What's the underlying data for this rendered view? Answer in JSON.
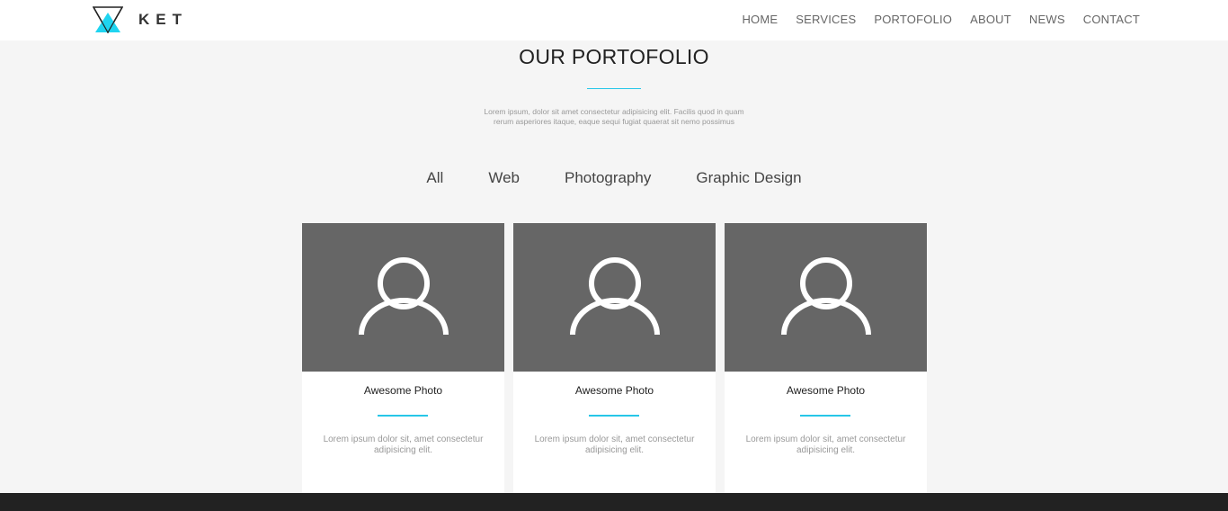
{
  "navbar": {
    "brand": "KET",
    "links": [
      "HOME",
      "SERVICES",
      "PORTOFOLIO",
      "ABOUT",
      "NEWS",
      "CONTACT"
    ]
  },
  "portfolio": {
    "title": "OUR PORTOFOLIO",
    "description": "Lorem ipsum, dolor sit amet consectetur adipisicing elit. Facilis quod in quam rerum asperiores itaque, eaque sequi fugiat quaerat sit nemo possimus",
    "filters": [
      "All",
      "Web",
      "Photography",
      "Graphic Design"
    ],
    "cards": [
      {
        "title": "Awesome Photo",
        "text": "Lorem ipsum dolor sit, amet consectetur adipisicing elit."
      },
      {
        "title": "Awesome Photo",
        "text": "Lorem ipsum dolor sit, amet consectetur adipisicing elit."
      },
      {
        "title": "Awesome Photo",
        "text": "Lorem ipsum dolor sit, amet consectetur adipisicing elit."
      }
    ]
  },
  "colors": {
    "accent": "#27c6e8",
    "card_image_bg": "#666666",
    "footer_bg": "#222222",
    "page_bg": "#f5f5f5"
  }
}
